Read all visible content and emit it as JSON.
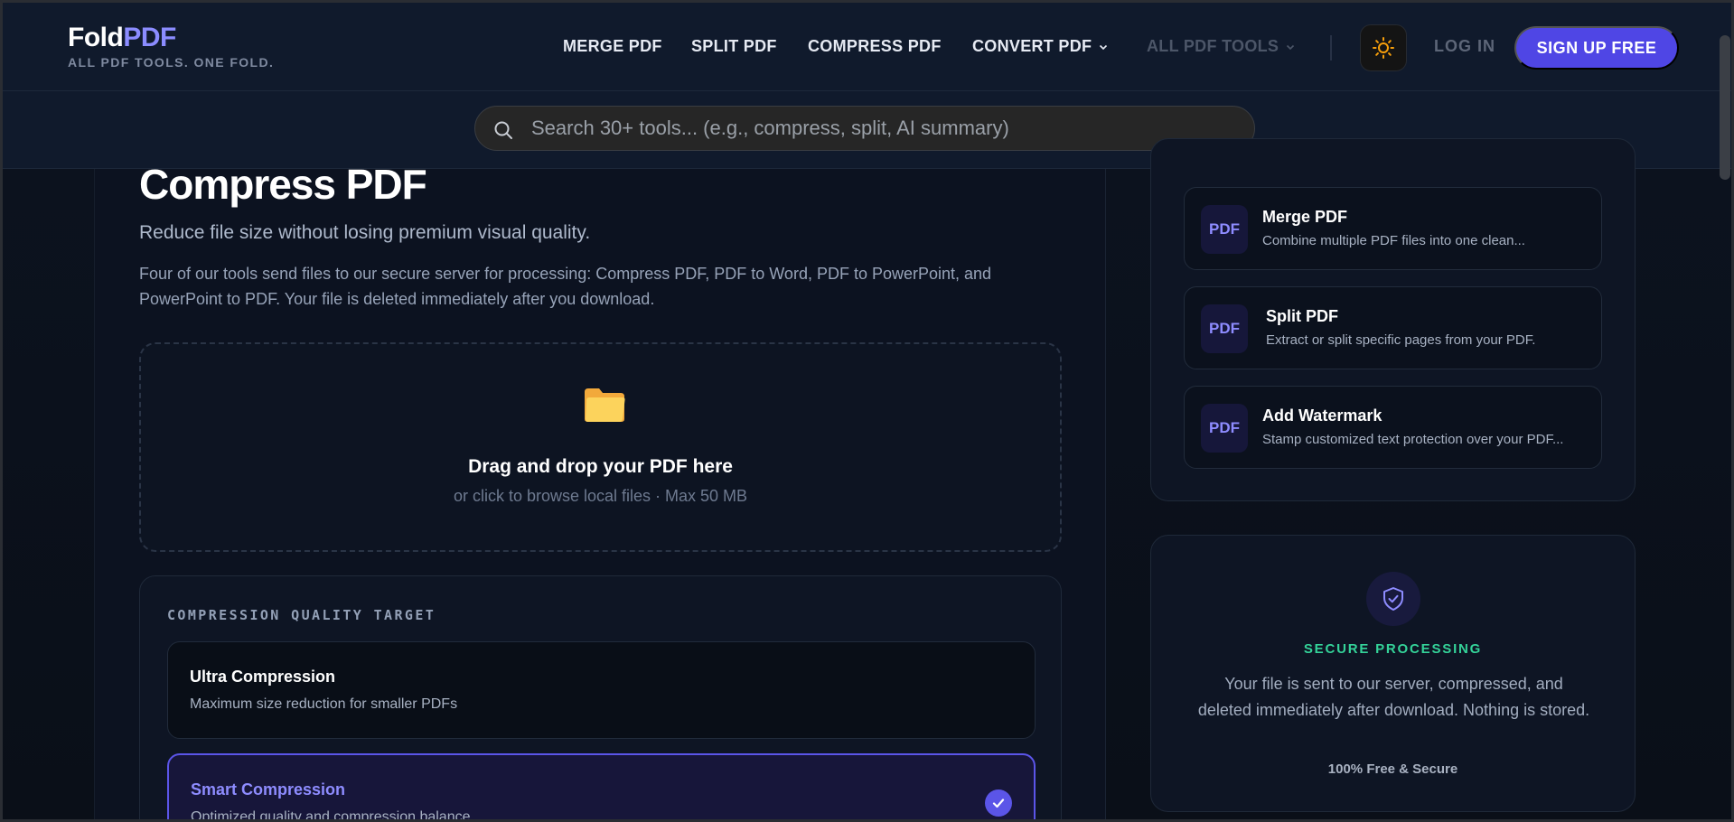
{
  "brand": {
    "name_a": "Fold",
    "name_b": "PDF",
    "tagline": "ALL PDF TOOLS. ONE FOLD."
  },
  "nav": {
    "merge": "MERGE PDF",
    "split": "SPLIT PDF",
    "compress": "COMPRESS PDF",
    "convert": "CONVERT PDF",
    "all_tools": "ALL PDF TOOLS",
    "login": "LOG IN",
    "signup": "SIGN UP FREE",
    "theme_icon": "sun-icon"
  },
  "search": {
    "placeholder": "Search 30+ tools... (e.g., compress, split, AI summary)",
    "value": ""
  },
  "page": {
    "title": "Compress PDF",
    "subtitle": "Reduce file size without losing premium visual quality.",
    "description": "Four of our tools send files to our secure server for processing: Compress PDF, PDF to Word, PDF to PowerPoint, and PowerPoint to PDF. Your file is deleted immediately after you download."
  },
  "dropzone": {
    "title": "Drag and drop your PDF here",
    "subtitle": "or click to browse local files · Max 50 MB"
  },
  "quality": {
    "heading": "COMPRESSION QUALITY TARGET",
    "options": [
      {
        "title": "Ultra Compression",
        "desc": "Maximum size reduction for smaller PDFs",
        "selected": false
      },
      {
        "title": "Smart Compression",
        "desc": "Optimized quality and compression balance",
        "selected": true
      }
    ]
  },
  "related_tools": [
    {
      "badge": "PDF",
      "name": "Merge PDF",
      "desc": "Combine multiple PDF files into one clean..."
    },
    {
      "badge": "PDF",
      "name": "Split PDF",
      "desc": "Extract or split specific pages from your PDF."
    },
    {
      "badge": "PDF",
      "name": "Add Watermark",
      "desc": "Stamp customized text protection over your PDF..."
    }
  ],
  "secure": {
    "title": "SECURE PROCESSING",
    "text": "Your file is sent to our server, compressed, and deleted immediately after download. Nothing is stored.",
    "footer": "100% Free & Secure"
  },
  "colors": {
    "accent": "#4f46e5",
    "accent_light": "#8b8cff",
    "success": "#34d399",
    "folder": "#fbbf24"
  }
}
